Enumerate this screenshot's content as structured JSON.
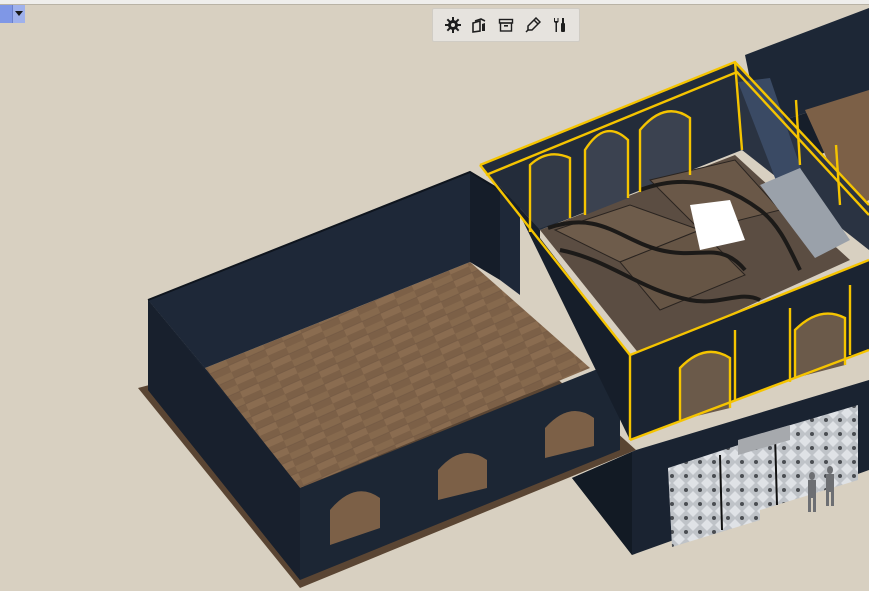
{
  "window": {
    "title": ""
  },
  "toolbar": {
    "buttons": [
      {
        "name": "settings-button",
        "icon": "gear-icon"
      },
      {
        "name": "component-button",
        "icon": "component-icon"
      },
      {
        "name": "archive-button",
        "icon": "archive-icon"
      },
      {
        "name": "edit-button",
        "icon": "eraser-pencil-icon"
      },
      {
        "name": "tools-button",
        "icon": "wrench-screwdriver-icon"
      }
    ]
  },
  "viewport": {
    "model": "3d-building-model",
    "colors": {
      "background": "#d8d0c1",
      "wall": "#1c2634",
      "floor": "#7a5f45",
      "selection": "#f5c400",
      "glass": "#c8ccd1"
    }
  }
}
